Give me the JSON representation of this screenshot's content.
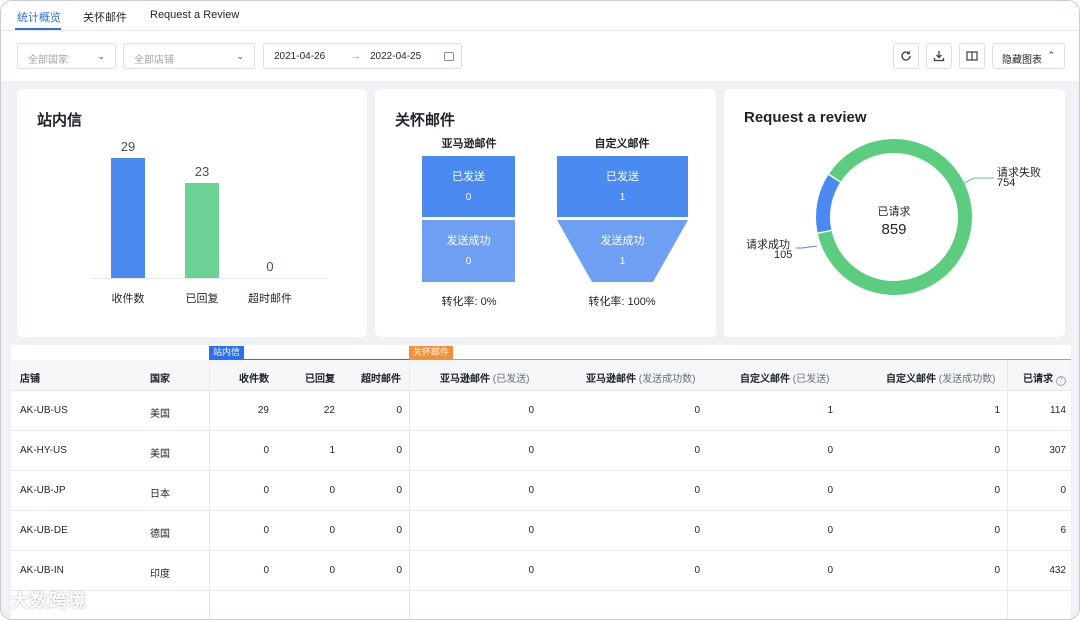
{
  "tabs": [
    {
      "label": "统计概览"
    },
    {
      "label": "关怀邮件"
    },
    {
      "label": "Request a Review"
    }
  ],
  "filters": {
    "country_placeholder": "全部国家",
    "store_placeholder": "全部店铺",
    "date_start": "2021-04-26",
    "date_end": "2022-04-25",
    "hide_charts_label": "隐藏图表"
  },
  "icons": [
    "refresh-icon",
    "download-icon",
    "columns-icon",
    "calendar-icon",
    "chevron-down-icon",
    "chevron-up-icon"
  ],
  "colors": {
    "accent": "#2f6ef2",
    "bar_blue": "#4b8af0",
    "bar_green": "#6bd195",
    "funnel_dark": "#4b8af0",
    "funnel_light": "#6f9ff2",
    "donut_green": "#5ccd7f",
    "donut_blue": "#4b8af0",
    "group_blue": "#2f6ef2",
    "group_orange": "#f08f3c"
  },
  "inbox": {
    "title": "站内信",
    "chart_data": {
      "type": "bar",
      "categories": [
        "收件数",
        "已回复",
        "超时邮件"
      ],
      "values": [
        29,
        23,
        0
      ],
      "ylim": [
        0,
        29
      ]
    }
  },
  "care": {
    "title": "关怀邮件",
    "amazon": {
      "head": "亚马逊邮件",
      "sent_label": "已发送",
      "sent": "0",
      "success_label": "发送成功",
      "success": "0",
      "conversion": "转化率: 0%"
    },
    "custom": {
      "head": "自定义邮件",
      "sent_label": "已发送",
      "sent": "1",
      "success_label": "发送成功",
      "success": "1",
      "conversion": "转化率: 100%"
    }
  },
  "review": {
    "title": "Request a review",
    "center_label": "已请求",
    "center_value": "859",
    "chart_data": {
      "type": "pie",
      "categories": [
        "请求失败",
        "请求成功"
      ],
      "values": [
        754,
        105
      ]
    },
    "fail_label": "请求失败",
    "fail_value": "754",
    "success_label": "请求成功",
    "success_value": "105"
  },
  "table": {
    "groups": {
      "inbox": "站内信",
      "care": "关怀邮件"
    },
    "headers": {
      "store": "店铺",
      "country": "国家",
      "received": "收件数",
      "replied": "已回复",
      "timeout": "超时邮件",
      "amz_sent": "亚马逊邮件",
      "amz_sent_sub": "(已发送)",
      "amz_success": "亚马逊邮件",
      "amz_success_sub": "(发送成功数)",
      "custom_sent": "自定义邮件",
      "custom_sent_sub": "(已发送)",
      "custom_success": "自定义邮件",
      "custom_success_sub": "(发送成功数)",
      "requested": "已请求"
    },
    "rows": [
      {
        "store": "AK-UB-US",
        "country": "美国",
        "received": "29",
        "replied": "22",
        "timeout": "0",
        "amz_sent": "0",
        "amz_success": "0",
        "custom_sent": "1",
        "custom_success": "1",
        "requested": "114"
      },
      {
        "store": "AK-HY-US",
        "country": "美国",
        "received": "0",
        "replied": "1",
        "timeout": "0",
        "amz_sent": "0",
        "amz_success": "0",
        "custom_sent": "0",
        "custom_success": "0",
        "requested": "307"
      },
      {
        "store": "AK-UB-JP",
        "country": "日本",
        "received": "0",
        "replied": "0",
        "timeout": "0",
        "amz_sent": "0",
        "amz_success": "0",
        "custom_sent": "0",
        "custom_success": "0",
        "requested": "0"
      },
      {
        "store": "AK-UB-DE",
        "country": "德国",
        "received": "0",
        "replied": "0",
        "timeout": "0",
        "amz_sent": "0",
        "amz_success": "0",
        "custom_sent": "0",
        "custom_success": "0",
        "requested": "6"
      },
      {
        "store": "AK-UB-IN",
        "country": "印度",
        "received": "0",
        "replied": "0",
        "timeout": "0",
        "amz_sent": "0",
        "amz_success": "0",
        "custom_sent": "0",
        "custom_success": "0",
        "requested": "432"
      }
    ]
  },
  "watermark": "大数跨境"
}
